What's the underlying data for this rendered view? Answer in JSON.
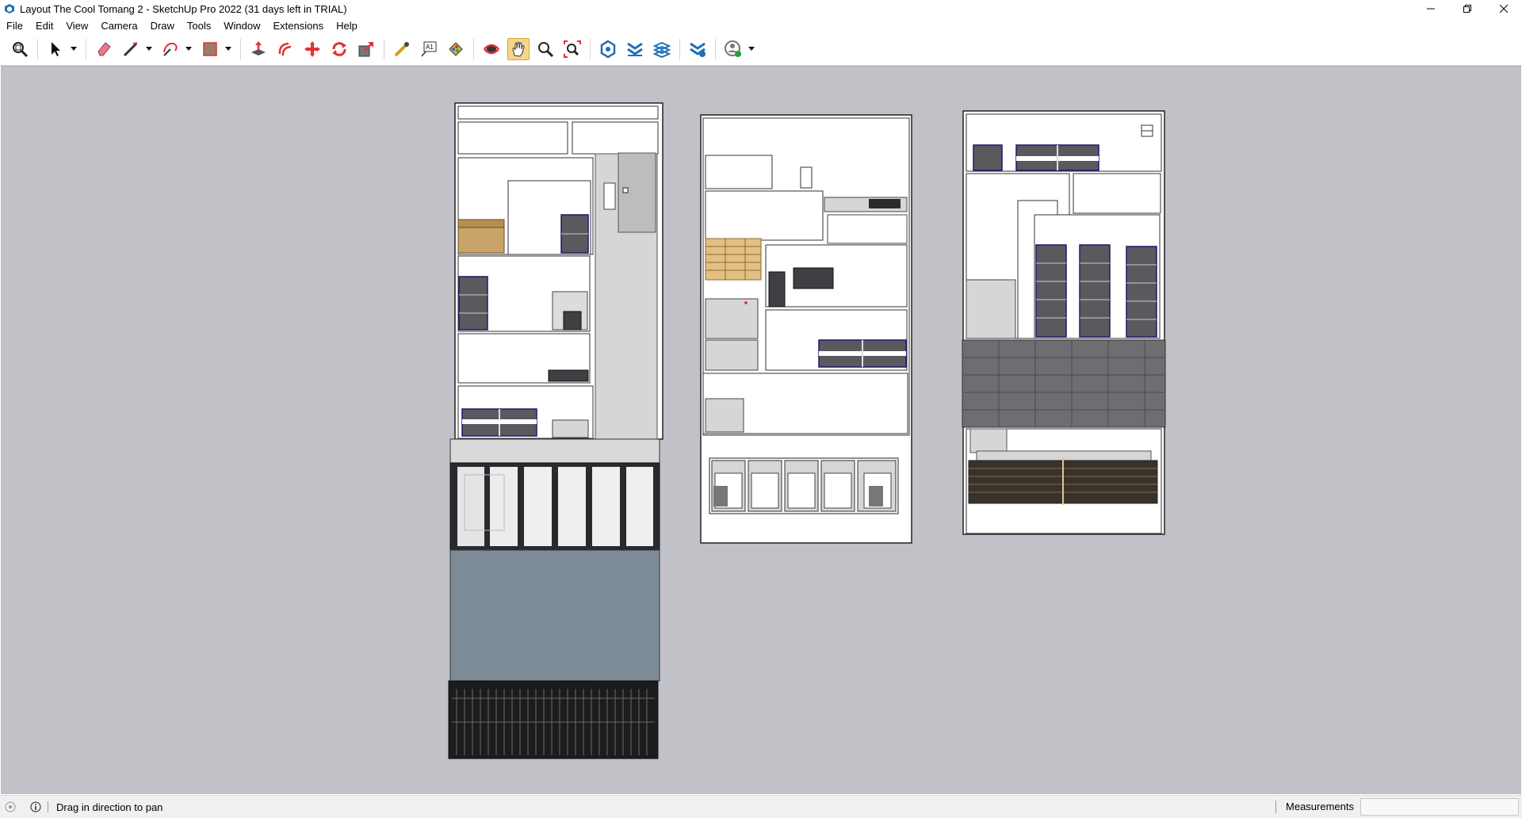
{
  "window": {
    "title": "Layout The Cool Tomang 2 - SketchUp Pro 2022 (31 days left in TRIAL)"
  },
  "menu": [
    "File",
    "Edit",
    "View",
    "Camera",
    "Draw",
    "Tools",
    "Window",
    "Extensions",
    "Help"
  ],
  "toolbar": {
    "tools": [
      {
        "name": "zoom-window-icon"
      },
      {
        "name": "select-icon",
        "dropdown": true
      },
      {
        "name": "eraser-icon"
      },
      {
        "name": "pencil-icon",
        "dropdown": true
      },
      {
        "name": "arc-icon",
        "dropdown": true
      },
      {
        "name": "rectangle-icon",
        "dropdown": true
      },
      {
        "name": "push-pull-icon"
      },
      {
        "name": "offset-icon"
      },
      {
        "name": "move-icon"
      },
      {
        "name": "rotate-icon"
      },
      {
        "name": "scale-icon"
      },
      {
        "name": "tape-measure-icon"
      },
      {
        "name": "text-icon"
      },
      {
        "name": "paint-bucket-icon"
      },
      {
        "name": "orbit-icon"
      },
      {
        "name": "pan-icon",
        "active": true
      },
      {
        "name": "zoom-icon"
      },
      {
        "name": "zoom-extents-icon"
      },
      {
        "name": "warehouse-icon"
      },
      {
        "name": "extension-warehouse-icon"
      },
      {
        "name": "layout-icon"
      },
      {
        "name": "extension-manager-icon"
      },
      {
        "name": "account-icon",
        "dropdown": true
      }
    ]
  },
  "status": {
    "hint": "Drag in direction to pan",
    "measurements_label": "Measurements",
    "measurements_value": ""
  },
  "colors": {
    "viewport_bg": "#c1c2c7",
    "wall_white": "#ffffff",
    "wall_gray": "#d6d6d6",
    "furniture_dark": "#5a5a5e",
    "glass_blue": "#7d8b98",
    "wood": "#c9a46a",
    "pan_active": "#f5d68c"
  }
}
